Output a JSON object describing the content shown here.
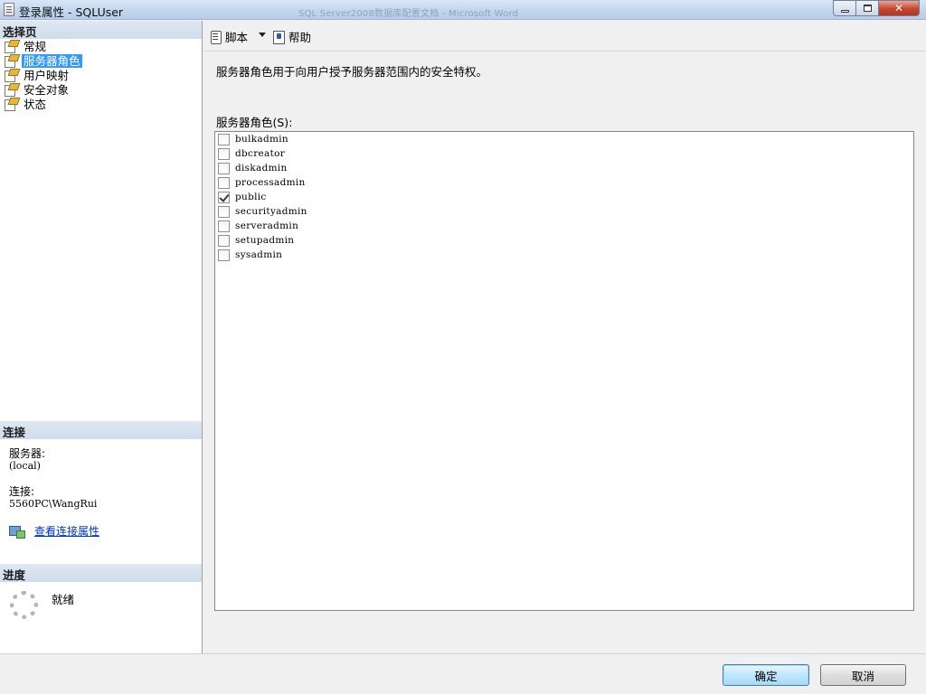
{
  "window": {
    "title": "登录属性 - SQLUser",
    "background_title": "SQL Server2008数据库配置文档 - Microsoft Word"
  },
  "left_panel": {
    "select_page_header": "选择页",
    "pages": [
      {
        "label": "常规",
        "selected": false
      },
      {
        "label": "服务器角色",
        "selected": true
      },
      {
        "label": "用户映射",
        "selected": false
      },
      {
        "label": "安全对象",
        "selected": false
      },
      {
        "label": "状态",
        "selected": false
      }
    ],
    "connection_header": "连接",
    "server_label": "服务器:",
    "server_value": "(local)",
    "connection_label": "连接:",
    "connection_value": "5560PC\\WangRui",
    "view_connection_link": "查看连接属性",
    "progress_header": "进度",
    "progress_status": "就绪"
  },
  "toolbar": {
    "script_label": "脚本",
    "help_label": "帮助"
  },
  "main": {
    "description": "服务器角色用于向用户授予服务器范围内的安全特权。",
    "roles_label": "服务器角色(S):",
    "roles": [
      {
        "name": "bulkadmin",
        "checked": false
      },
      {
        "name": "dbcreator",
        "checked": false
      },
      {
        "name": "diskadmin",
        "checked": false
      },
      {
        "name": "processadmin",
        "checked": false
      },
      {
        "name": "public",
        "checked": true
      },
      {
        "name": "securityadmin",
        "checked": false
      },
      {
        "name": "serveradmin",
        "checked": false
      },
      {
        "name": "setupadmin",
        "checked": false
      },
      {
        "name": "sysadmin",
        "checked": false
      }
    ]
  },
  "buttons": {
    "ok_label": "确定",
    "cancel_label": "取消"
  },
  "colors": {
    "selection": "#3399ff",
    "section_header": "#d3dfee",
    "link": "#0033cc"
  }
}
